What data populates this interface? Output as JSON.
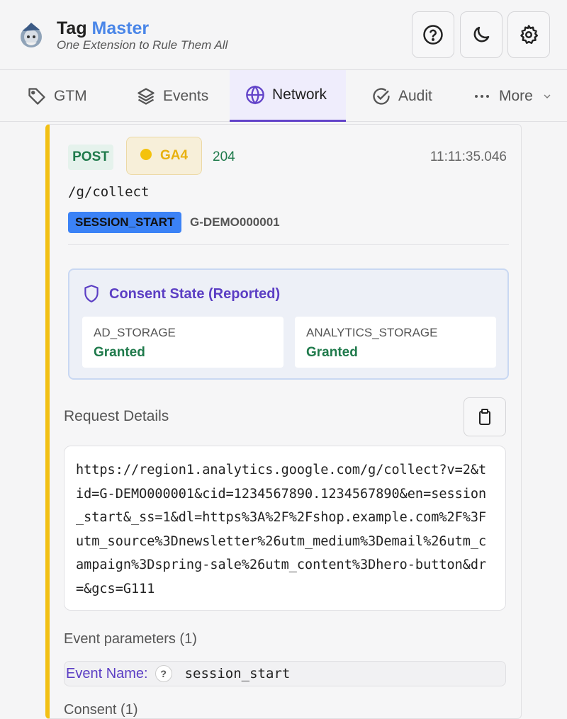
{
  "app": {
    "title_main": "Tag",
    "title_accent": "Master",
    "tagline": "One Extension to Rule Them All"
  },
  "header_buttons": [
    {
      "name": "help",
      "icon": "question-circle-icon"
    },
    {
      "name": "theme",
      "icon": "moon-icon"
    },
    {
      "name": "settings",
      "icon": "gear-icon"
    }
  ],
  "tabs": [
    {
      "label": "GTM",
      "icon": "tag-icon",
      "active": false
    },
    {
      "label": "Events",
      "icon": "layers-icon",
      "active": false
    },
    {
      "label": "Network",
      "icon": "globe-icon",
      "active": true
    },
    {
      "label": "Audit",
      "icon": "check-circle-icon",
      "active": false
    },
    {
      "label": "More",
      "icon": "ellipsis-icon",
      "active": false
    }
  ],
  "request": {
    "method": "POST",
    "vendor": "GA4",
    "status": "204",
    "time": "11:11:35.046",
    "path": "/g/collect",
    "event": "SESSION_START",
    "measurement_id": "G-DEMO000001"
  },
  "consent": {
    "title": "Consent State (Reported)",
    "items": [
      {
        "key": "AD_STORAGE",
        "value": "Granted"
      },
      {
        "key": "ANALYTICS_STORAGE",
        "value": "Granted"
      }
    ]
  },
  "details": {
    "title": "Request Details",
    "url": "https://region1.analytics.google.com/g/collect?v=2&tid=G-DEMO000001&cid=1234567890.1234567890&en=session_start&_ss=1&dl=https%3A%2F%2Fshop.example.com%2F%3Futm_source%3Dnewsletter%26utm_medium%3Demail%26utm_campaign%3Dspring-sale%26utm_content%3Dhero-button&dr=&gcs=G111"
  },
  "params": {
    "title": "Event parameters (1)",
    "items": [
      {
        "key": "Event Name:",
        "help": "?",
        "value": "session_start"
      }
    ]
  },
  "consent_section_label": "Consent (1)",
  "colors": {
    "accent": "#4a86e8",
    "active_tab": "#6344c9",
    "ga4_yellow": "#f4c20d",
    "success_green": "#1f7a4b"
  }
}
